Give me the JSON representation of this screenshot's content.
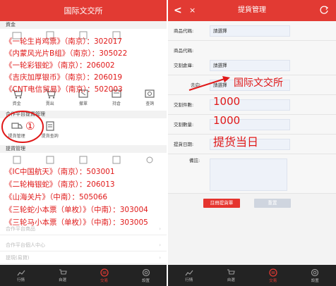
{
  "left": {
    "title": "国际文交所",
    "section_funds": "資金",
    "funds_labels": [
      "資金",
      "交易",
      "撤單",
      "持倉",
      "查詢"
    ],
    "funds_row2": [
      "資金",
      "賣出",
      "撤單",
      "持倉",
      "查詢"
    ],
    "section_platform": "合作平台提貨管理",
    "platform_labels": [
      "提貨管理",
      "提貨查詢"
    ],
    "section_pickup": "提貨管理",
    "pickup_row_labels": [
      "",
      "",
      "",
      "",
      ""
    ],
    "faded_rows": [
      "合作平台商品",
      "合作平台個人中心",
      "提現(易貸)"
    ]
  },
  "annotations": {
    "group1": [
      "《一轮生肖鸡票》（南京）：302017",
      "《内蒙风光片B组》（南京）：305022",
      "《一轮彩银蛇》（南京）：206002",
      "《吉庆加厚银币》（南京）：206019",
      "《CNT电信贸易》（南京）：502003"
    ],
    "group2": [
      "《IC中国航天》（南京）：503001",
      "《二轮梅银蛇》（南京）：206013",
      "《山海关片》（中南）：505066",
      "《三轮蛇小本票（单枚）》（中南）：303004",
      "《三轮马小本票（单枚）》（中南）：303005"
    ],
    "circle_number": "①",
    "arrow_text": "国际文交所",
    "qty1": "1000",
    "qty2": "1000",
    "date_text": "提货当日"
  },
  "right": {
    "title": "提貨管理",
    "back": "<",
    "close": "×",
    "labels": {
      "product_code": "商品代碼:",
      "product_code2": "商品代碼:",
      "warehouse": "交割倉庫:",
      "destination": "去向:",
      "count": "交割件數:",
      "qty": "交割數量:",
      "date": "提貨日期:",
      "remark": "備註:"
    },
    "values": {
      "product_code": "請選擇",
      "product_code2": "",
      "warehouse": "請選擇",
      "destination": "請選擇"
    },
    "submit": "註冊提貨單",
    "reset": "重置"
  },
  "nav": [
    {
      "label": "行情",
      "icon": "chart-icon"
    },
    {
      "label": "自選",
      "icon": "cart-icon"
    },
    {
      "label": "交易",
      "icon": "trade-icon"
    },
    {
      "label": "設置",
      "icon": "settings-icon"
    }
  ],
  "colors": {
    "header_red": "#e23a33",
    "annotation_red": "#e01818",
    "nav_dark": "#232323"
  }
}
